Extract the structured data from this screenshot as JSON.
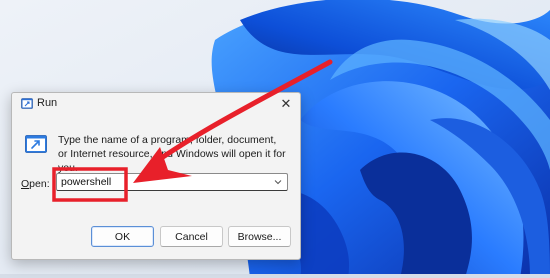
{
  "dialog": {
    "title": "Run",
    "close_glyph": "✕",
    "description": "Type the name of a program, folder, document, or Internet resource, and Windows will open it for you.",
    "open_label_accel": "O",
    "open_label_rest": "pen:",
    "open_value": "powershell",
    "buttons": {
      "ok": "OK",
      "cancel": "Cancel",
      "browse": "Browse..."
    }
  },
  "icons": {
    "title": "run-icon",
    "large": "run-program-icon",
    "close": "close-icon",
    "dropdown": "chevron-down-icon"
  },
  "colors": {
    "annotation_red": "#e8202a",
    "wallpaper_blue": "#1f6fe8",
    "wallpaper_bg": "#e9eef5"
  }
}
